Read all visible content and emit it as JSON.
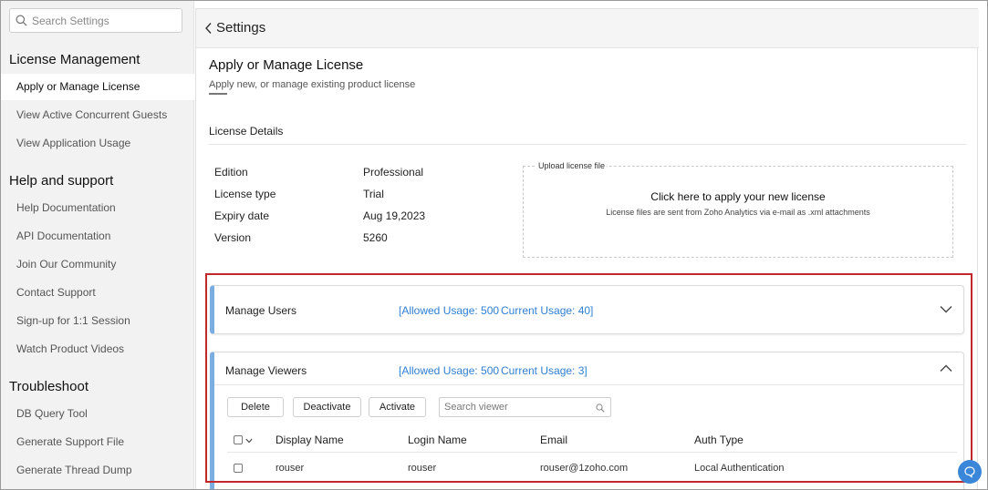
{
  "search": {
    "placeholder": "Search Settings"
  },
  "sidebar": {
    "sections": [
      {
        "title": "License Management",
        "items": [
          "Apply or Manage License",
          "View Active Concurrent Guests",
          "View Application Usage"
        ]
      },
      {
        "title": "Help and support",
        "items": [
          "Help Documentation",
          "API Documentation",
          "Join Our Community",
          "Contact Support",
          "Sign-up for 1:1 Session",
          "Watch Product Videos"
        ]
      },
      {
        "title": "Troubleshoot",
        "items": [
          "DB Query Tool",
          "Generate Support File",
          "Generate Thread Dump"
        ]
      }
    ],
    "active_item": "Apply or Manage License"
  },
  "header": {
    "back_label": "Settings"
  },
  "page": {
    "title": "Apply or Manage License",
    "subtitle": "Apply new, or manage existing product license"
  },
  "license_details": {
    "title": "License Details",
    "rows": [
      {
        "label": "Edition",
        "value": "Professional"
      },
      {
        "label": "License type",
        "value": "Trial"
      },
      {
        "label": "Expiry date",
        "value": "Aug 19,2023"
      },
      {
        "label": "Version",
        "value": "5260"
      }
    ]
  },
  "upload": {
    "legend": "Upload license file",
    "main": "Click here to apply your new license",
    "sub": "License files are sent from Zoho Analytics via e-mail as .xml attachments"
  },
  "manage_users": {
    "title": "Manage Users",
    "allowed": "[Allowed Usage: 500",
    "current": "Current Usage: 40]"
  },
  "manage_viewers": {
    "title": "Manage Viewers",
    "allowed": "[Allowed Usage: 500",
    "current": "Current Usage: 3]",
    "buttons": {
      "delete": "Delete",
      "deactivate": "Deactivate",
      "activate": "Activate"
    },
    "search_placeholder": "Search viewer",
    "columns": [
      "Display Name",
      "Login Name",
      "Email",
      "Auth Type"
    ],
    "rows": [
      {
        "display_name": "rouser",
        "login_name": "rouser",
        "email": "rouser@1zoho.com",
        "auth_type": "Local Authentication"
      }
    ]
  },
  "colors": {
    "accent": "#2f7fd3",
    "panel_stripe": "#7aaee0",
    "highlight": "#c0282b",
    "fab": "#3a86d8"
  }
}
